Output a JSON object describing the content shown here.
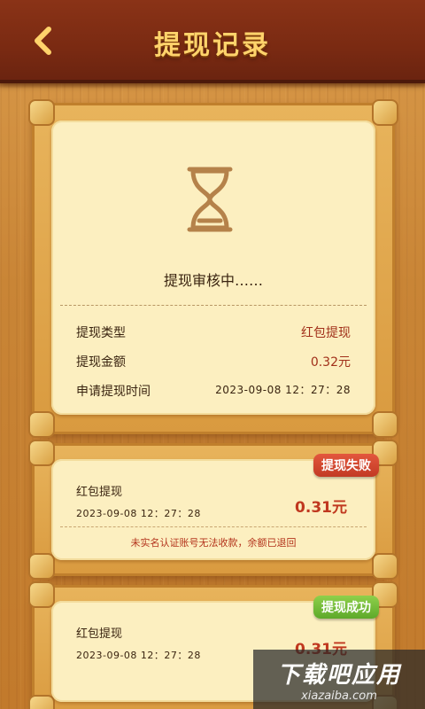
{
  "header": {
    "title": "提现记录",
    "back_icon": "chevron-left-icon"
  },
  "pending": {
    "icon": "hourglass-icon",
    "status": "提现审核中……",
    "rows": [
      {
        "label": "提现类型",
        "value": "红包提现"
      },
      {
        "label": "提现金额",
        "value": "0.32元"
      },
      {
        "label": "申请提现时间",
        "value": "2023-09-08 12：27：28"
      }
    ]
  },
  "records": [
    {
      "badge": "提现失败",
      "type": "红包提现",
      "time": "2023-09-08 12：27：28",
      "amount": "0.31元",
      "note": "未实名认证账号无法收款，余额已退回"
    },
    {
      "badge": "提现成功",
      "type": "红包提现",
      "time": "2023-09-08 12：27：28",
      "amount": "0.31元"
    }
  ],
  "watermark": {
    "title": "下载吧应用",
    "url": "xiazaiba.com"
  },
  "colors": {
    "header_bg": "#7a2a12",
    "title": "#ffd36b",
    "card_bg": "#fcefc0",
    "amount": "#c0381f",
    "fail_badge": "#d2452f",
    "success_badge": "#75bd38"
  }
}
